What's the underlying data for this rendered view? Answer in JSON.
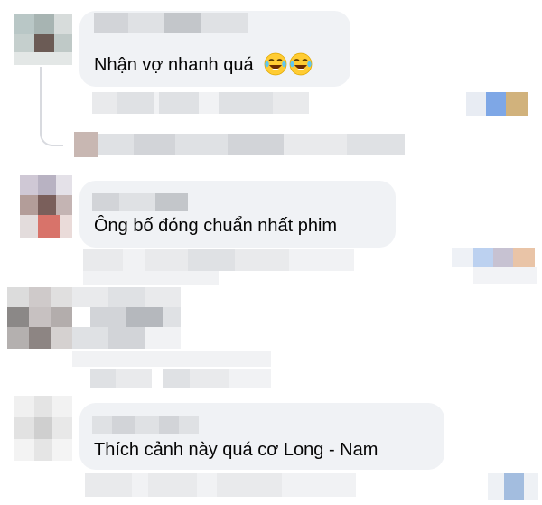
{
  "comments": [
    {
      "text": "Nhận vợ nhanh quá",
      "emoji": [
        "laughing-tears-emoji",
        "laughing-tears-emoji"
      ]
    },
    {
      "text": "Ông bố đóng chuẩn nhất phim"
    },
    {
      "text": "Thích cảnh này quá cơ Long  - Nam"
    }
  ],
  "colors": {
    "bubble": "#f0f2f5",
    "text": "#050505",
    "thread_line": "#d8dadf"
  }
}
